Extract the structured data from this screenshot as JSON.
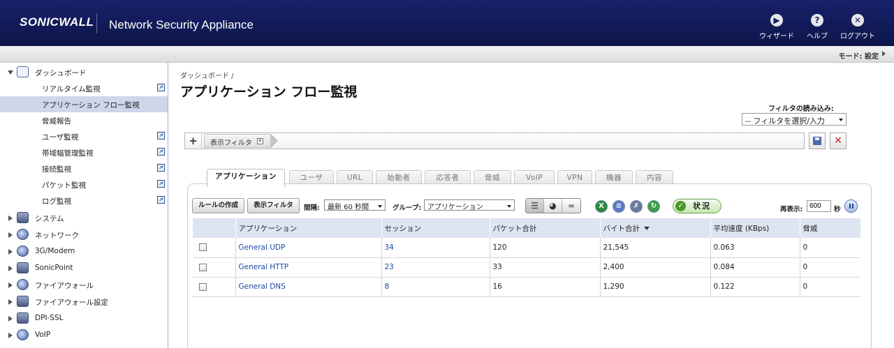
{
  "header": {
    "logo": "SONICWALL",
    "app_title": "Network Security Appliance",
    "actions": [
      {
        "label": "ウィザード",
        "icon": "wizard-icon"
      },
      {
        "label": "ヘルプ",
        "icon": "help-icon"
      },
      {
        "label": "ログアウト",
        "icon": "logout-icon"
      }
    ],
    "mode_text": "モード: 設定"
  },
  "sidebar": {
    "dashboard": {
      "label": "ダッシュボード",
      "icon": "dashboard-icon"
    },
    "dashboard_items": [
      {
        "label": "リアルタイム監視",
        "popout": true
      },
      {
        "label": "アプリケーション フロー監視",
        "popout": false,
        "selected": true
      },
      {
        "label": "脅威報告",
        "popout": false
      },
      {
        "label": "ユーザ監視",
        "popout": true
      },
      {
        "label": "帯域幅管理監視",
        "popout": true
      },
      {
        "label": "接続監視",
        "popout": true
      },
      {
        "label": "パケット監視",
        "popout": true
      },
      {
        "label": "ログ監視",
        "popout": true
      }
    ],
    "categories": [
      {
        "label": "システム",
        "icon": "system-icon"
      },
      {
        "label": "ネットワーク",
        "icon": "network-icon"
      },
      {
        "label": "3G/Modem",
        "icon": "modem-icon"
      },
      {
        "label": "SonicPoint",
        "icon": "sonicpoint-icon"
      },
      {
        "label": "ファイアウォール",
        "icon": "firewall-icon"
      },
      {
        "label": "ファイアウォール設定",
        "icon": "firewall-settings-icon"
      },
      {
        "label": "DPI-SSL",
        "icon": "dpi-ssl-icon"
      },
      {
        "label": "VoIP",
        "icon": "voip-icon"
      }
    ]
  },
  "main": {
    "breadcrumb": "ダッシュボード /",
    "title": "アプリケーション フロー監視",
    "filter_load_label": "フィルタの読み込み:",
    "filter_load_value": "-- フィルタを選択/入力",
    "filter_chip": "表示フィルタ",
    "tabs": [
      "アプリケーション",
      "ユーザ",
      "URL",
      "始動者",
      "応答者",
      "脅威",
      "VoIP",
      "VPN",
      "機器",
      "内容"
    ],
    "toolbar": {
      "create_rule": "ルールの作成",
      "view_filter": "表示フィルタ",
      "interval_label": "間隔:",
      "interval_value": "最新 60 秒間",
      "group_label": "グループ:",
      "group_value": "アプリケーション",
      "status": "状況",
      "refresh_label": "再表示:",
      "refresh_value": "600",
      "refresh_unit": "秒"
    },
    "table": {
      "columns": [
        "",
        "アプリケーション",
        "セッション",
        "パケット合計",
        "バイト合計",
        "平均速度 (KBps)",
        "脅威"
      ],
      "rows": [
        [
          "",
          "General UDP",
          "34",
          "120",
          "21,545",
          "0.063",
          "0"
        ],
        [
          "",
          "General HTTP",
          "23",
          "33",
          "2,400",
          "0.084",
          "0"
        ],
        [
          "",
          "General DNS",
          "8",
          "16",
          "1,290",
          "0.122",
          "0"
        ]
      ]
    }
  }
}
